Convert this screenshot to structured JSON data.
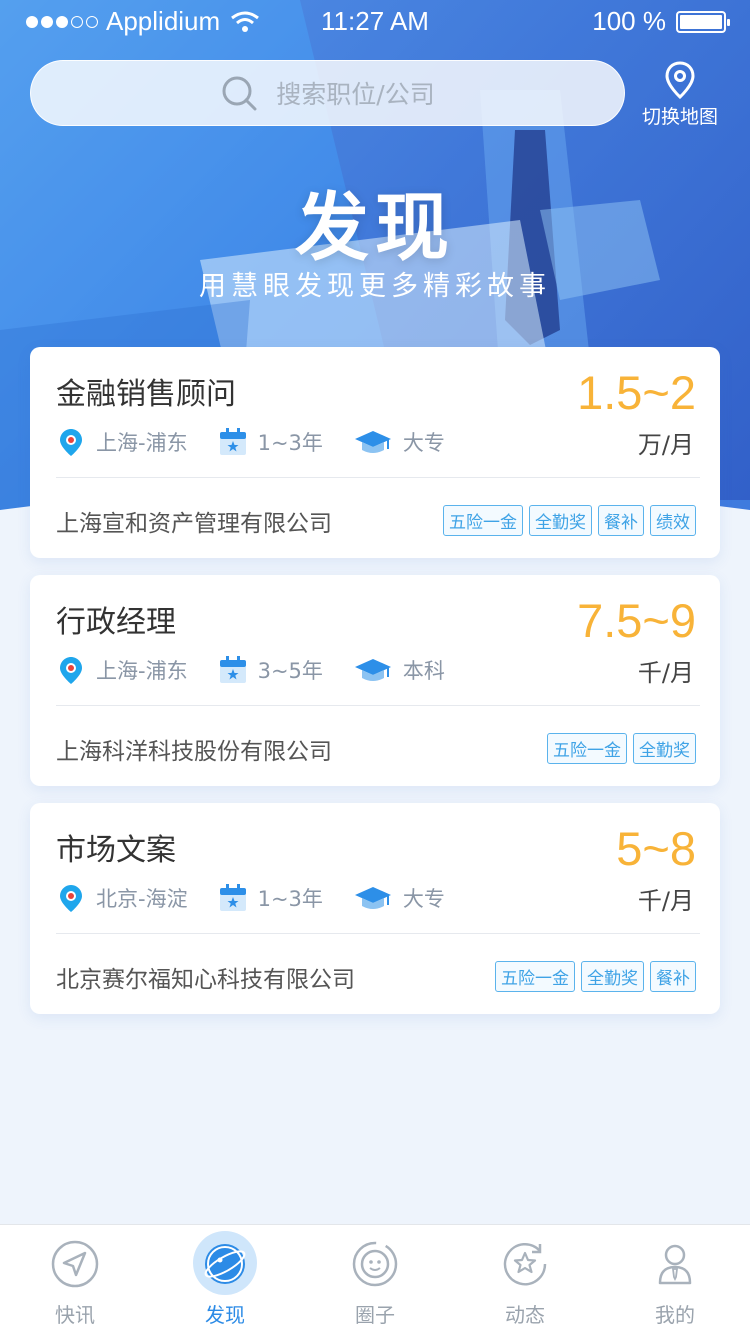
{
  "status_bar": {
    "carrier": "Applidium",
    "time": "11:27 AM",
    "battery": "100 %"
  },
  "search": {
    "placeholder": "搜索职位/公司"
  },
  "map_switch": {
    "label": "切换地图"
  },
  "hero": {
    "title": "发现",
    "subtitle": "用慧眼发现更多精彩故事"
  },
  "jobs": [
    {
      "title": "金融销售顾问",
      "salary": "1.5~2",
      "salary_unit": "万/月",
      "location": "上海-浦东",
      "experience": "1~3年",
      "education": "大专",
      "company": "上海宣和资产管理有限公司",
      "tags": [
        "五险一金",
        "全勤奖",
        "餐补",
        "绩效"
      ]
    },
    {
      "title": "行政经理",
      "salary": "7.5~9",
      "salary_unit": "千/月",
      "location": "上海-浦东",
      "experience": "3~5年",
      "education": "本科",
      "company": "上海科洋科技股份有限公司",
      "tags": [
        "五险一金",
        "全勤奖"
      ]
    },
    {
      "title": "市场文案",
      "salary": "5~8",
      "salary_unit": "千/月",
      "location": "北京-海淀",
      "experience": "1~3年",
      "education": "大专",
      "company": "北京赛尔福知心科技有限公司",
      "tags": [
        "五险一金",
        "全勤奖",
        "餐补"
      ]
    }
  ],
  "tabs": [
    {
      "label": "快讯",
      "icon": "send-icon",
      "active": false
    },
    {
      "label": "发现",
      "icon": "planet-icon",
      "active": true
    },
    {
      "label": "圈子",
      "icon": "circle-face-icon",
      "active": false
    },
    {
      "label": "动态",
      "icon": "star-refresh-icon",
      "active": false
    },
    {
      "label": "我的",
      "icon": "user-icon",
      "active": false
    }
  ],
  "colors": {
    "accent": "#2c8be6",
    "salary": "#f8b338",
    "tag_border": "#5bb3ec",
    "hero_start": "#5aa6f0",
    "hero_end": "#3b6fd8"
  }
}
